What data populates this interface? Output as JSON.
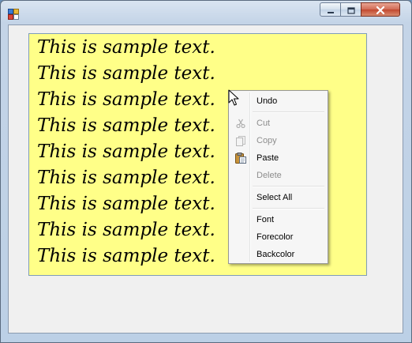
{
  "window": {
    "title": "",
    "controls": {
      "minimize": "minimize-icon",
      "maximize": "maximize-icon",
      "close": "close-icon"
    }
  },
  "textbox": {
    "background": "#ffff88",
    "lines": [
      "This is sample text.",
      "This is sample text.",
      "This is sample text.",
      "This is sample text.",
      "This is sample text.",
      "This is sample text.",
      "This is sample text.",
      "This is sample text.",
      "This is sample text."
    ]
  },
  "context_menu": {
    "items": [
      {
        "label": "Undo",
        "icon": "",
        "enabled": true
      },
      {
        "label": "Cut",
        "icon": "scissors-icon",
        "enabled": false
      },
      {
        "label": "Copy",
        "icon": "copy-icon",
        "enabled": false
      },
      {
        "label": "Paste",
        "icon": "paste-icon",
        "enabled": true
      },
      {
        "label": "Delete",
        "icon": "",
        "enabled": false
      },
      {
        "label": "Select All",
        "icon": "",
        "enabled": true
      },
      {
        "label": "Font",
        "icon": "",
        "enabled": true
      },
      {
        "label": "Forecolor",
        "icon": "",
        "enabled": true
      },
      {
        "label": "Backcolor",
        "icon": "",
        "enabled": true
      }
    ]
  }
}
